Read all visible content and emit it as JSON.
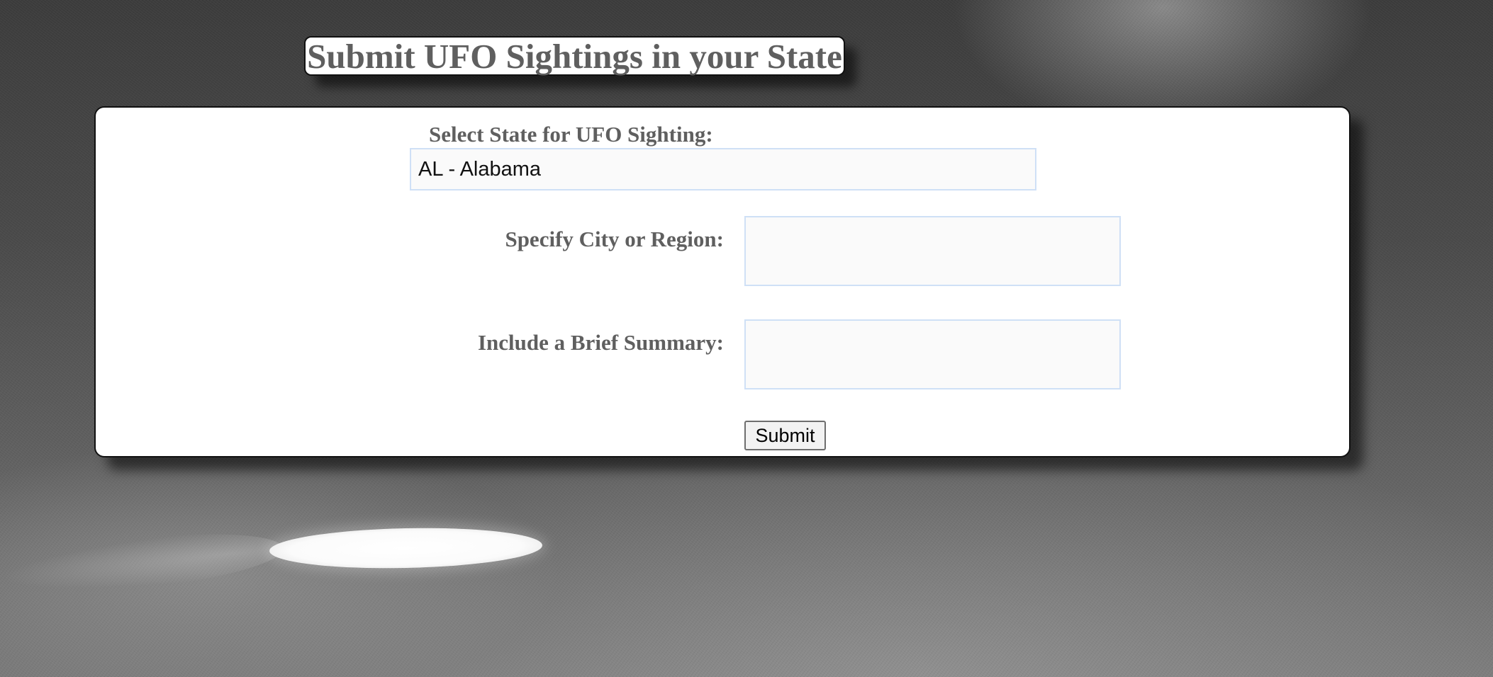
{
  "page": {
    "title": "Submit UFO Sightings in your State"
  },
  "form": {
    "state_label": "Select State for UFO Sighting:",
    "state_selected": "AL - Alabama",
    "city_label": "Specify City or Region:",
    "city_value": "",
    "summary_label": "Include a Brief Summary:",
    "summary_value": "",
    "submit_label": "Submit"
  },
  "colors": {
    "label_text": "#5f5f5f",
    "field_border": "#cfe0f6",
    "panel_border": "#111111"
  }
}
